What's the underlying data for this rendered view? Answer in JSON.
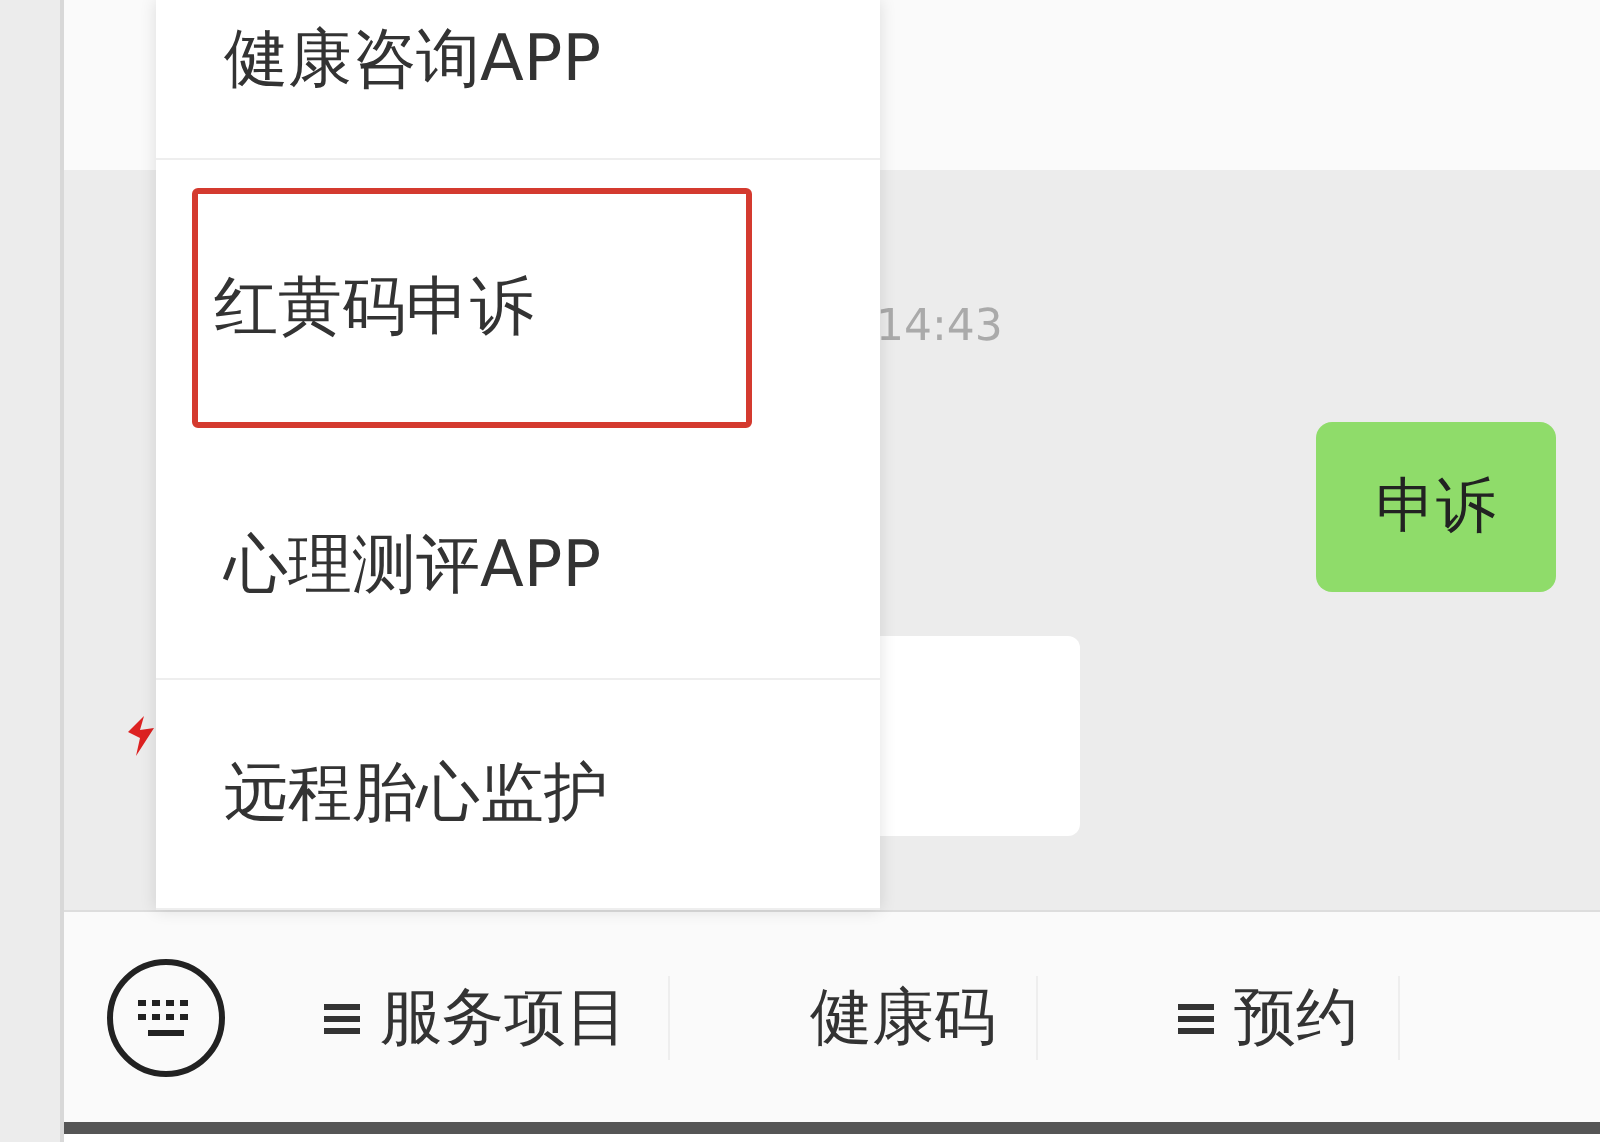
{
  "popup_menu": {
    "items": [
      {
        "label": "健康咨询APP",
        "selected": false
      },
      {
        "label": "红黄码申诉",
        "selected": true
      },
      {
        "label": "心理测评APP",
        "selected": false
      },
      {
        "label": "远程胎心监护",
        "selected": false
      }
    ]
  },
  "chat": {
    "timestamp": "14:43",
    "messages": [
      {
        "kind": "outgoing",
        "text": "申诉"
      },
      {
        "kind": "incoming"
      }
    ]
  },
  "bottom_menu": {
    "items": [
      {
        "label": "服务项目",
        "submenu": true
      },
      {
        "label": "健康码",
        "submenu": false
      },
      {
        "label": "预约",
        "submenu": true
      }
    ]
  }
}
